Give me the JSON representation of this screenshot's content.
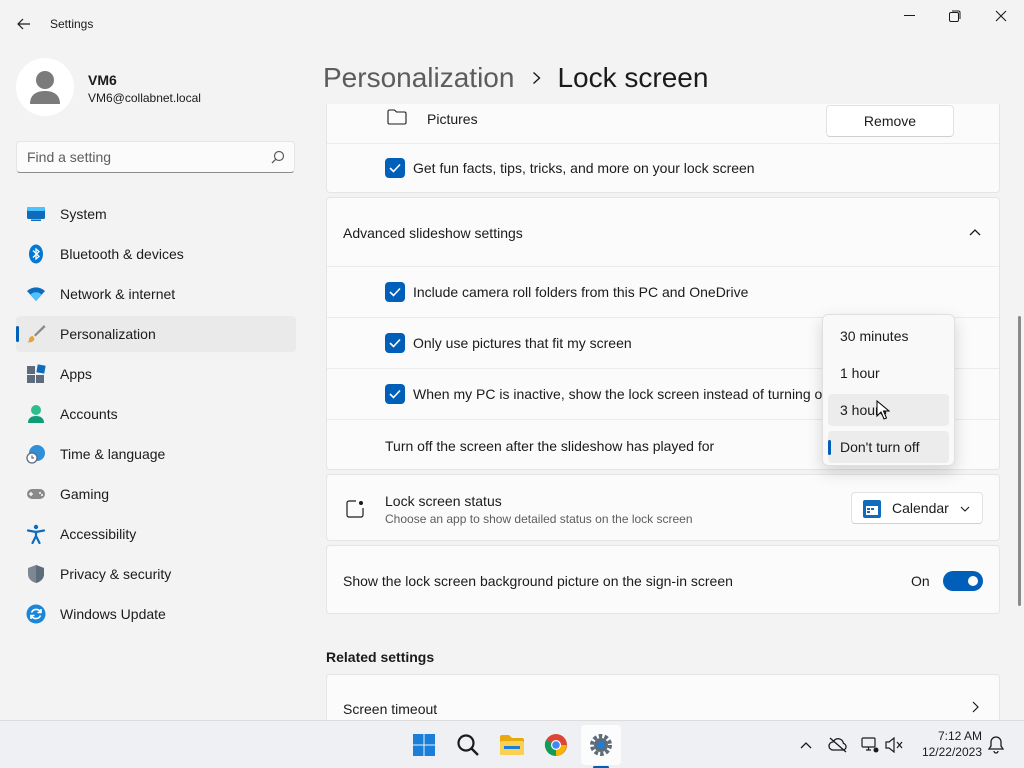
{
  "window": {
    "app_title": "Settings"
  },
  "profile": {
    "name": "VM6",
    "email": "VM6@collabnet.local"
  },
  "search": {
    "placeholder": "Find a setting"
  },
  "nav": [
    {
      "label": "System",
      "icon": "system-icon"
    },
    {
      "label": "Bluetooth & devices",
      "icon": "bluetooth-icon"
    },
    {
      "label": "Network & internet",
      "icon": "wifi-icon"
    },
    {
      "label": "Personalization",
      "icon": "brush-icon",
      "active": true
    },
    {
      "label": "Apps",
      "icon": "apps-icon"
    },
    {
      "label": "Accounts",
      "icon": "accounts-icon"
    },
    {
      "label": "Time & language",
      "icon": "globe-clock-icon"
    },
    {
      "label": "Gaming",
      "icon": "gamepad-icon"
    },
    {
      "label": "Accessibility",
      "icon": "accessibility-icon"
    },
    {
      "label": "Privacy & security",
      "icon": "shield-icon"
    },
    {
      "label": "Windows Update",
      "icon": "windows-update-icon"
    }
  ],
  "header": {
    "parent": "Personalization",
    "current": "Lock screen"
  },
  "slideshow": {
    "folder_name": "Pictures",
    "remove_label": "Remove",
    "fun_facts_label": "Get fun facts, tips, tricks, and more on your lock screen",
    "fun_facts_checked": true
  },
  "advanced": {
    "title": "Advanced slideshow settings",
    "camera_roll_label": "Include camera roll folders from this PC and OneDrive",
    "camera_roll_checked": true,
    "fit_screen_label": "Only use pictures that fit my screen",
    "fit_screen_checked": true,
    "inactive_label": "When my PC is inactive, show the lock screen instead of turning of",
    "inactive_checked": true,
    "turn_off_label": "Turn off the screen after the slideshow has played for"
  },
  "dropdown": {
    "options": [
      "30 minutes",
      "1 hour",
      "3 hours",
      "Don't turn off"
    ],
    "hovered": "3 hours",
    "selected": "Don't turn off"
  },
  "status": {
    "title": "Lock screen status",
    "description": "Choose an app to show detailed status on the lock screen",
    "selected_app": "Calendar"
  },
  "signin": {
    "label": "Show the lock screen background picture on the sign-in screen",
    "state_label": "On",
    "enabled": true
  },
  "related": {
    "heading": "Related settings",
    "screen_timeout": "Screen timeout"
  },
  "taskbar": {
    "apps": [
      "start-icon",
      "search-icon",
      "file-explorer-icon",
      "chrome-icon",
      "settings-icon"
    ],
    "time": "7:12 AM",
    "date": "12/22/2023"
  },
  "colors": {
    "accent": "#005fb8",
    "background": "#f3f3f3",
    "card": "#fbfbfb"
  }
}
